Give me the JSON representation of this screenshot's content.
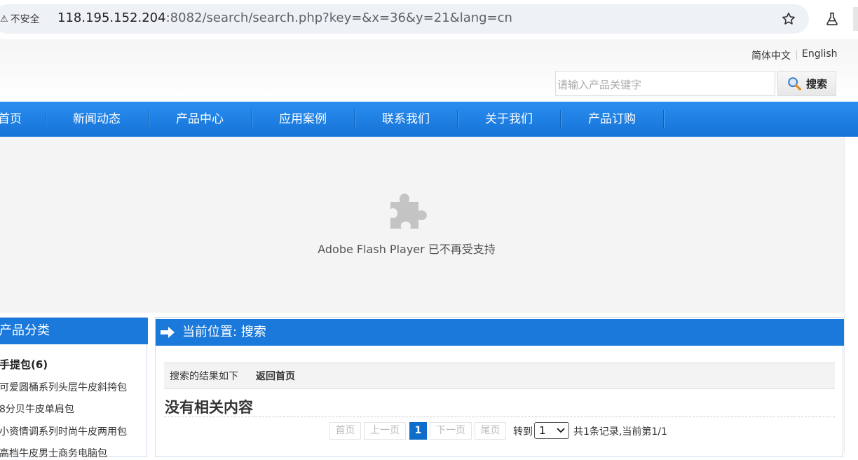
{
  "browser": {
    "security_label": "不安全",
    "url_host": "118.195.152.204",
    "url_rest": ":8082/search/search.php?key=&x=36&y=21&lang=cn"
  },
  "header": {
    "lang_cn": "简体中文",
    "lang_en": "English",
    "search_placeholder": "请输入产品关键字",
    "search_button": "搜索"
  },
  "nav": {
    "items": [
      "首页",
      "新闻动态",
      "产品中心",
      "应用案例",
      "联系我们",
      "关于我们",
      "产品订购"
    ]
  },
  "flash": {
    "message": "Adobe Flash Player 已不再受支持"
  },
  "sidebar": {
    "title": "产品分类",
    "category": "手提包(6)",
    "items": [
      "可爱圆桶系列头层牛皮斜挎包",
      "8分贝牛皮单肩包",
      "小资情调系列时尚牛皮两用包",
      "高档牛皮男士商务电脑包"
    ]
  },
  "main": {
    "breadcrumb": "当前位置: 搜索",
    "result_label": "搜索的结果如下",
    "back_home": "返回首页",
    "no_content": "没有相关内容",
    "pager": {
      "first": "首页",
      "prev": "上一页",
      "current": "1",
      "next": "下一页",
      "last": "尾页",
      "goto_label": "转到",
      "select_value": "1",
      "summary": "共1条记录,当前第1/1"
    }
  },
  "colors": {
    "nav_blue": "#1a79db",
    "page_active": "#0f6ec9"
  }
}
